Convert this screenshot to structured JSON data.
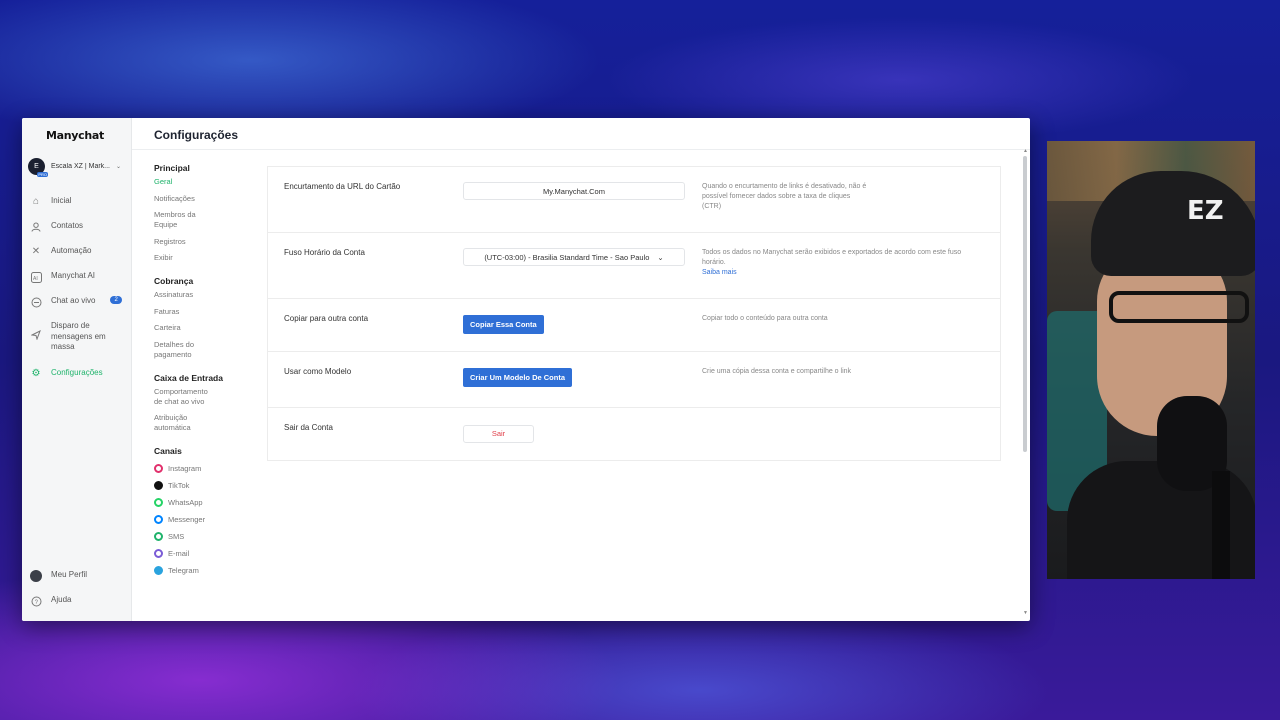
{
  "app": {
    "logo": "Manychat",
    "account": {
      "initials": "E",
      "pro": "PRO",
      "name": "Escala XZ | Mark..."
    },
    "nav": [
      {
        "label": "Inicial",
        "icon": "home-icon",
        "glyph": "⌂"
      },
      {
        "label": "Contatos",
        "icon": "user-icon",
        "glyph": "👤"
      },
      {
        "label": "Automação",
        "icon": "automation-icon",
        "glyph": "✕"
      },
      {
        "label": "Manychat AI",
        "icon": "ai-icon",
        "glyph": "▣"
      },
      {
        "label": "Chat ao vivo",
        "icon": "chat-icon",
        "glyph": "◌",
        "badge": "2"
      },
      {
        "label": "Disparo de mensagens em massa",
        "icon": "broadcast-icon",
        "glyph": "➤"
      },
      {
        "label": "Configurações",
        "icon": "settings-icon",
        "glyph": "⚙"
      }
    ],
    "bottom": [
      {
        "label": "Meu Perfil",
        "icon": "profile-avatar"
      },
      {
        "label": "Ajuda",
        "icon": "help-icon",
        "glyph": "?"
      }
    ]
  },
  "header": {
    "title": "Configurações"
  },
  "subnav": {
    "groups": [
      {
        "title": "Principal",
        "items": [
          "Geral",
          "Notificações",
          "Membros da Equipe",
          "Registros",
          "Exibir"
        ]
      },
      {
        "title": "Cobrança",
        "items": [
          "Assinaturas",
          "Faturas",
          "Carteira",
          "Detalhes do pagamento"
        ]
      },
      {
        "title": "Caixa de Entrada",
        "items": [
          "Comportamento de chat ao vivo",
          "Atribuição automática"
        ]
      }
    ],
    "channels_title": "Canais",
    "channels": [
      {
        "label": "Instagram",
        "color": "#e1306c"
      },
      {
        "label": "TikTok",
        "color": "#111111"
      },
      {
        "label": "WhatsApp",
        "color": "#25d366"
      },
      {
        "label": "Messenger",
        "color": "#0084ff"
      },
      {
        "label": "SMS",
        "color": "#1fb36b"
      },
      {
        "label": "E-mail",
        "color": "#7b5cd6"
      },
      {
        "label": "Telegram",
        "color": "#2aa3de"
      }
    ]
  },
  "settings": {
    "url_shortening": {
      "label": "Encurtamento da URL do Cartão",
      "value": "My.Manychat.Com",
      "desc": "Quando o encurtamento de links é desativado, não é possível fornecer dados sobre a taxa de cliques (CTR)"
    },
    "timezone": {
      "label": "Fuso Horário da Conta",
      "value": "(UTC-03:00) - Brasilia Standard Time - Sao Paulo",
      "desc": "Todos os dados no Manychat serão exibidos e exportados de acordo com este fuso horário.",
      "link": "Saiba mais"
    },
    "copy_account": {
      "label": "Copiar para outra conta",
      "button": "Copiar Essa Conta",
      "desc": "Copiar todo o conteúdo para outra conta"
    },
    "template": {
      "label": "Usar como Modelo",
      "button": "Criar Um Modelo De Conta",
      "desc": "Crie uma cópia dessa conta e compartilhe o link"
    },
    "logout": {
      "label": "Sair da Conta",
      "button": "Sair"
    }
  },
  "colors": {
    "accent": "#1fb36b",
    "primary_button": "#2f6fd6",
    "danger": "#e0414b"
  },
  "webcam": {
    "cap_logo": "EZ"
  }
}
